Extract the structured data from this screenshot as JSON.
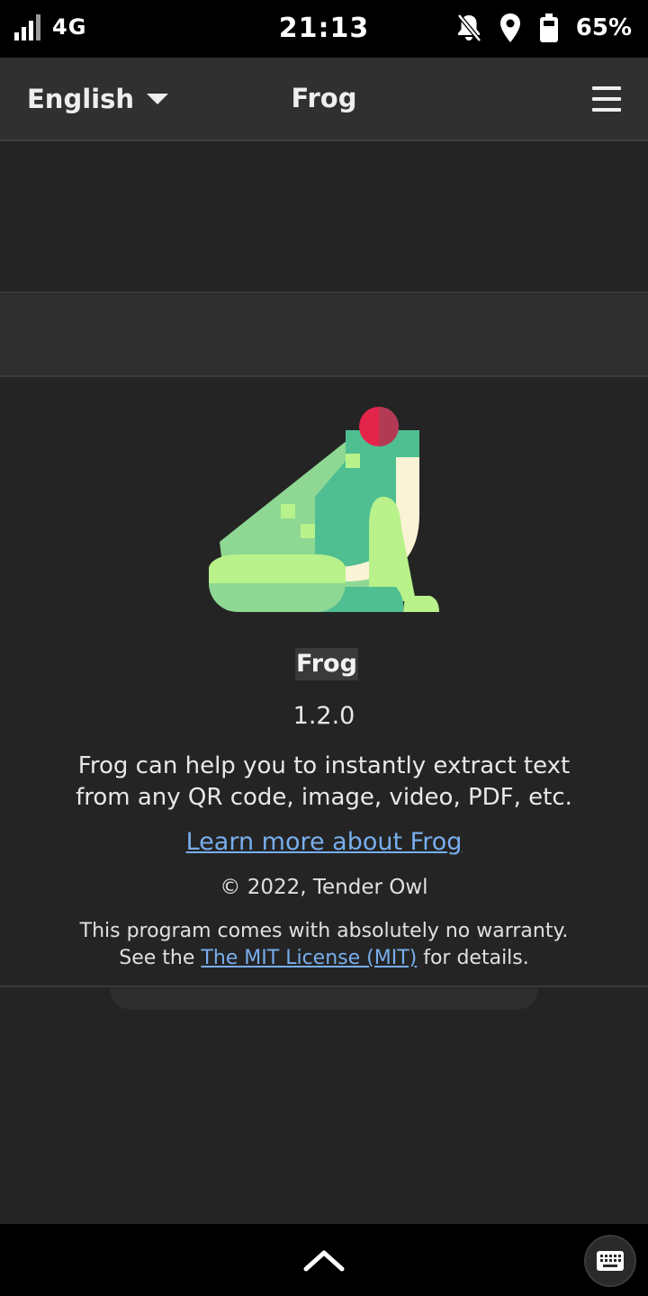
{
  "status_bar": {
    "network": "4G",
    "time": "21:13",
    "battery_percent": "65%",
    "icons": [
      "signal-icon",
      "notifications-off-icon",
      "location-icon",
      "battery-icon"
    ]
  },
  "header": {
    "language": "English",
    "title": "Frog",
    "menu_icon": "hamburger-menu-icon"
  },
  "about": {
    "app_name": "Frog",
    "version": "1.2.0",
    "description": "Frog can help you to instantly extract text from any QR code, image, video, PDF, etc.",
    "website_label": "Learn more about Frog",
    "copyright": "© 2022, Tender Owl",
    "warranty_prefix": "This program comes with absolutely no warranty.",
    "warranty_see": "See the",
    "license_label": "The MIT License (MIT)",
    "warranty_suffix": "for details.",
    "logo_icon": "frog-logo-icon"
  },
  "nav_bar": {
    "up_icon": "chevron-up-icon",
    "keyboard_icon": "keyboard-icon"
  },
  "colors": {
    "background": "#242424",
    "headerbar": "#303030",
    "link": "#78aeed",
    "frog_light": "#8ed893",
    "frog_teal": "#4fbf92",
    "frog_lime": "#b9f18a",
    "frog_cream": "#fbf3d5",
    "frog_eye": "#e3244b"
  }
}
